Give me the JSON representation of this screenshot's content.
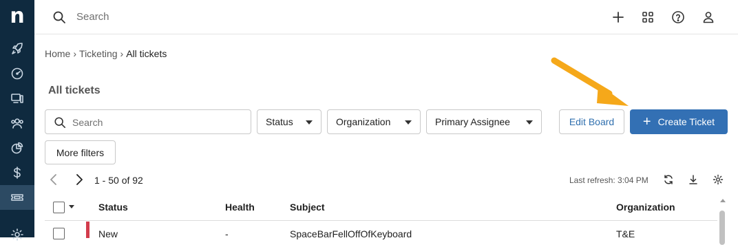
{
  "app": {
    "logo_text": "n"
  },
  "sidebar": {
    "items": [
      {
        "icon": "rocket-icon",
        "active": false
      },
      {
        "icon": "dashboard-icon",
        "active": false
      },
      {
        "icon": "devices-icon",
        "active": false
      },
      {
        "icon": "users-icon",
        "active": false
      },
      {
        "icon": "reports-icon",
        "active": false
      },
      {
        "icon": "billing-icon",
        "active": false
      },
      {
        "icon": "ticket-icon",
        "active": true
      },
      {
        "icon": "settings-icon",
        "active": false
      }
    ]
  },
  "topbar": {
    "search_placeholder": "Search",
    "icons": [
      "add-icon",
      "apps-grid-icon",
      "help-icon",
      "user-icon"
    ]
  },
  "breadcrumb": {
    "items": [
      "Home",
      "Ticketing",
      "All tickets"
    ]
  },
  "page": {
    "title": "All tickets"
  },
  "filters": {
    "search_placeholder": "Search",
    "status_label": "Status",
    "organization_label": "Organization",
    "assignee_label": "Primary Assignee",
    "more_label": "More filters"
  },
  "actions": {
    "edit_board_label": "Edit Board",
    "create_ticket_label": "Create Ticket",
    "create_icon": "+"
  },
  "pager": {
    "range_text": "1 - 50 of 92",
    "last_refresh": "Last refresh: 3:04 PM"
  },
  "table": {
    "columns": [
      "Status",
      "Health",
      "Subject",
      "Organization"
    ],
    "rows": [
      {
        "status": "New",
        "health": "-",
        "subject": "SpaceBarFellOffOfKeyboard",
        "organization": "T&E"
      }
    ]
  },
  "colors": {
    "sidebar_bg": "#0f2a3f",
    "primary": "#3370b4",
    "status_new": "#d23c4c",
    "annotation_arrow": "#f5a81a"
  }
}
